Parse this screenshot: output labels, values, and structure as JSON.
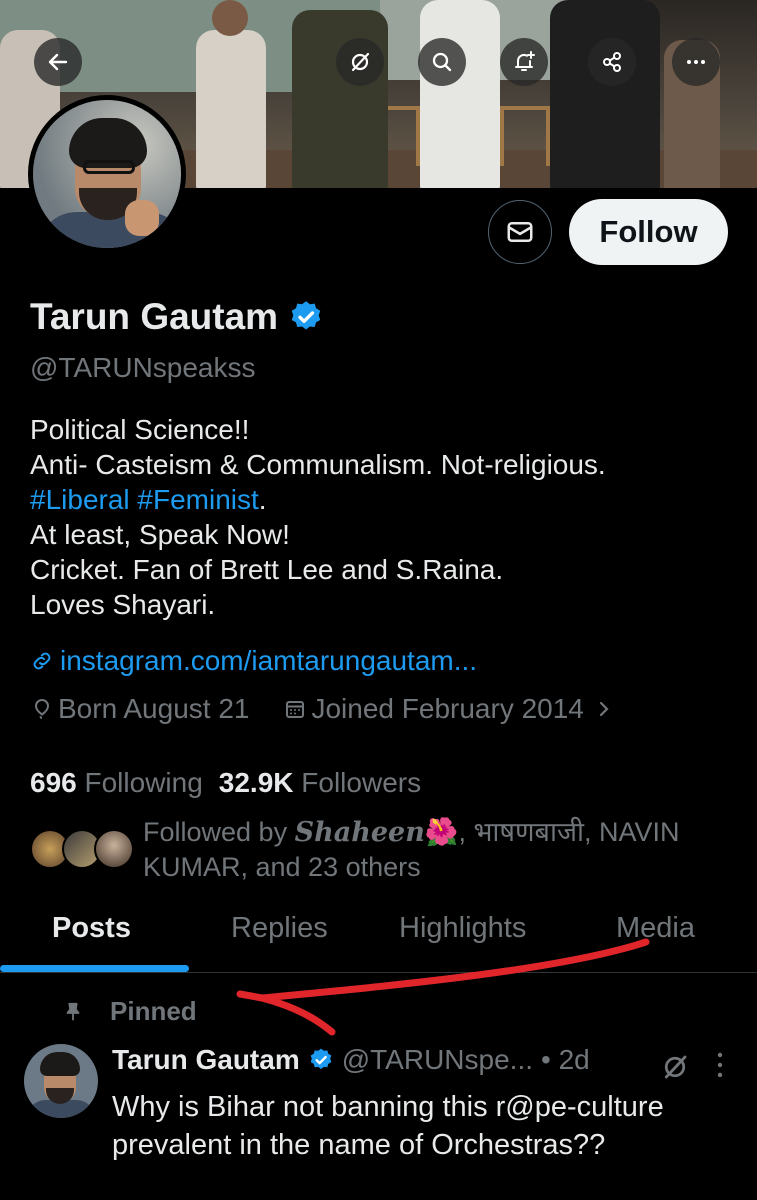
{
  "profile": {
    "name": "Tarun Gautam",
    "handle": "@TARUNspeakss",
    "follow_label": "Follow",
    "bio_lines": [
      "Political Science!!",
      "Anti- Casteism & Communalism. Not-religious."
    ],
    "bio_hashtags": [
      "#Liberal",
      "#Feminist"
    ],
    "bio_hashtag_suffix": ".",
    "bio_lines_after": [
      "At least, Speak Now!",
      "Cricket. Fan of Brett Lee and S.Raina.",
      "Loves Shayari."
    ],
    "link": "instagram.com/iamtarungautam...",
    "born": "Born August 21",
    "joined": "Joined February 2014",
    "following_count": "696",
    "following_label": "Following",
    "followers_count": "32.9K",
    "followers_label": "Followers",
    "followed_by_prefix": "Followed by ",
    "followed_by_name": "Shaheen",
    "followed_by_emoji": "🌺",
    "followed_by_rest": ", भाषणबाजी, NAVIN KUMAR, and 23 others"
  },
  "tabs": [
    {
      "label": "Posts",
      "active": true
    },
    {
      "label": "Replies",
      "active": false
    },
    {
      "label": "Highlights",
      "active": false
    },
    {
      "label": "Media",
      "active": false
    }
  ],
  "pinned_label": "Pinned",
  "tweet": {
    "name": "Tarun Gautam",
    "handle": "@TARUNspe...",
    "time": "• 2d",
    "text": "Why is Bihar not banning this r@pe-culture prevalent in the name of Orchestras??"
  },
  "colors": {
    "accent": "#1d9bf0",
    "annotation_arrow": "#e0262a"
  },
  "icons": [
    "back-arrow-icon",
    "grok-icon",
    "search-icon",
    "bell-plus-icon",
    "share-icon",
    "more-icon",
    "mail-icon",
    "verified-icon",
    "link-icon",
    "location-icon",
    "calendar-icon",
    "chevron-right-icon",
    "pin-icon"
  ]
}
